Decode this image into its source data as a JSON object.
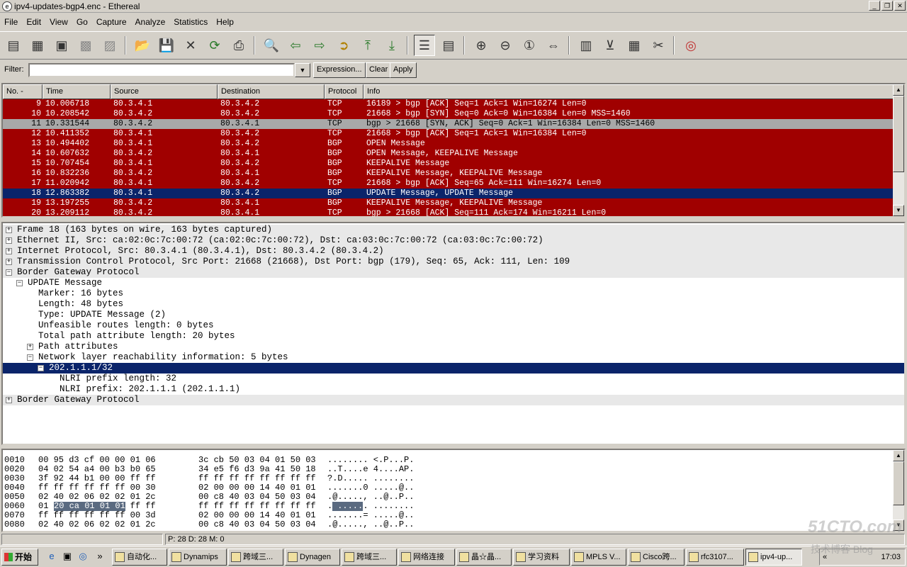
{
  "window": {
    "title": "ipv4-updates-bgp4.enc - Ethereal"
  },
  "menu": [
    "File",
    "Edit",
    "View",
    "Go",
    "Capture",
    "Analyze",
    "Statistics",
    "Help"
  ],
  "filter": {
    "label": "Filter:",
    "value": "",
    "expression": "Expression...",
    "clear": "Clear",
    "apply": "Apply"
  },
  "columns": [
    "No. -",
    "Time",
    "Source",
    "Destination",
    "Protocol",
    "Info"
  ],
  "colors": {
    "tcp_bg": "#a00000",
    "bgp_bg": "#a00000",
    "synack_bg": "#a8a8a8",
    "selected_bg": "#0a246a",
    "row_fg": "#ffffff"
  },
  "packets": [
    {
      "no": "9",
      "time": "10.006718",
      "src": "80.3.4.1",
      "dst": "80.3.4.2",
      "proto": "TCP",
      "info": "16189 > bgp [ACK] Seq=1 Ack=1 Win=16274 Len=0",
      "style": "red"
    },
    {
      "no": "10",
      "time": "10.208542",
      "src": "80.3.4.2",
      "dst": "80.3.4.2",
      "proto": "TCP",
      "info": "21668 > bgp [SYN] Seq=0 Ack=0 Win=16384 Len=0 MSS=1460",
      "style": "red"
    },
    {
      "no": "11",
      "time": "10.331544",
      "src": "80.3.4.2",
      "dst": "80.3.4.1",
      "proto": "TCP",
      "info": "bgp > 21668 [SYN, ACK] Seq=0 Ack=1 Win=16384 Len=0 MSS=1460",
      "style": "gray"
    },
    {
      "no": "12",
      "time": "10.411352",
      "src": "80.3.4.1",
      "dst": "80.3.4.2",
      "proto": "TCP",
      "info": "21668 > bgp [ACK] Seq=1 Ack=1 Win=16384 Len=0",
      "style": "red"
    },
    {
      "no": "13",
      "time": "10.494402",
      "src": "80.3.4.1",
      "dst": "80.3.4.2",
      "proto": "BGP",
      "info": "OPEN Message",
      "style": "red"
    },
    {
      "no": "14",
      "time": "10.607632",
      "src": "80.3.4.2",
      "dst": "80.3.4.1",
      "proto": "BGP",
      "info": "OPEN Message, KEEPALIVE Message",
      "style": "red"
    },
    {
      "no": "15",
      "time": "10.707454",
      "src": "80.3.4.1",
      "dst": "80.3.4.2",
      "proto": "BGP",
      "info": "KEEPALIVE Message",
      "style": "red"
    },
    {
      "no": "16",
      "time": "10.832236",
      "src": "80.3.4.2",
      "dst": "80.3.4.1",
      "proto": "BGP",
      "info": "KEEPALIVE Message, KEEPALIVE Message",
      "style": "red"
    },
    {
      "no": "17",
      "time": "11.020942",
      "src": "80.3.4.1",
      "dst": "80.3.4.2",
      "proto": "TCP",
      "info": "21668 > bgp [ACK] Seq=65 Ack=111 Win=16274 Len=0",
      "style": "red"
    },
    {
      "no": "18",
      "time": "12.863382",
      "src": "80.3.4.1",
      "dst": "80.3.4.2",
      "proto": "BGP",
      "info": "UPDATE Message, UPDATE Message",
      "style": "selected"
    },
    {
      "no": "19",
      "time": "13.197255",
      "src": "80.3.4.2",
      "dst": "80.3.4.1",
      "proto": "BGP",
      "info": "KEEPALIVE Message, KEEPALIVE Message",
      "style": "red"
    },
    {
      "no": "20",
      "time": "13.209112",
      "src": "80.3.4.2",
      "dst": "80.3.4.1",
      "proto": "TCP",
      "info": "bgp > 21668 [ACK] Seq=111 Ack=174 Win=16211 Len=0",
      "style": "red"
    }
  ],
  "details": [
    {
      "level": 0,
      "expander": "+",
      "text": "Frame 18 (163 bytes on wire, 163 bytes captured)",
      "shaded": true
    },
    {
      "level": 0,
      "expander": "+",
      "text": "Ethernet II, Src: ca:02:0c:7c:00:72 (ca:02:0c:7c:00:72), Dst: ca:03:0c:7c:00:72 (ca:03:0c:7c:00:72)",
      "shaded": true
    },
    {
      "level": 0,
      "expander": "+",
      "text": "Internet Protocol, Src: 80.3.4.1 (80.3.4.1), Dst: 80.3.4.2 (80.3.4.2)",
      "shaded": true
    },
    {
      "level": 0,
      "expander": "+",
      "text": "Transmission Control Protocol, Src Port: 21668 (21668), Dst Port: bgp (179), Seq: 65, Ack: 111, Len: 109",
      "shaded": true
    },
    {
      "level": 0,
      "expander": "-",
      "text": "Border Gateway Protocol",
      "shaded": true
    },
    {
      "level": 1,
      "expander": "-",
      "text": "UPDATE Message"
    },
    {
      "level": 2,
      "expander": "",
      "text": "Marker: 16 bytes"
    },
    {
      "level": 2,
      "expander": "",
      "text": "Length: 48 bytes"
    },
    {
      "level": 2,
      "expander": "",
      "text": "Type: UPDATE Message (2)"
    },
    {
      "level": 2,
      "expander": "",
      "text": "Unfeasible routes length: 0 bytes"
    },
    {
      "level": 2,
      "expander": "",
      "text": "Total path attribute length: 20 bytes"
    },
    {
      "level": 2,
      "expander": "+",
      "text": "Path attributes"
    },
    {
      "level": 2,
      "expander": "-",
      "text": "Network layer reachability information: 5 bytes"
    },
    {
      "level": 3,
      "expander": "-",
      "text": "202.1.1.1/32",
      "selected": true
    },
    {
      "level": 4,
      "expander": "",
      "text": "NLRI prefix length: 32"
    },
    {
      "level": 4,
      "expander": "",
      "text": "NLRI prefix: 202.1.1.1 (202.1.1.1)"
    },
    {
      "level": 0,
      "expander": "+",
      "text": "Border Gateway Protocol",
      "shaded": true
    }
  ],
  "hex": [
    {
      "off": "0010",
      "a": "00 95 d3 cf 00 00 01 06",
      "b": "3c cb 50 03 04 01 50 03",
      "ascii": "........ <.P...P."
    },
    {
      "off": "0020",
      "a": "04 02 54 a4 00 b3 b0 65",
      "b": "34 e5 f6 d3 9a 41 50 18",
      "ascii": "..T....e 4....AP."
    },
    {
      "off": "0030",
      "a": "3f 92 44 b1 00 00 ff ff",
      "b": "ff ff ff ff ff ff ff ff",
      "ascii": "?.D..... ........"
    },
    {
      "off": "0040",
      "a": "ff ff ff ff ff ff 00 30",
      "b": "02 00 00 00 14 40 01 01",
      "ascii": ".......0 .....@.."
    },
    {
      "off": "0050",
      "a": "02 40 02 06 02 02 01 2c",
      "b": "00 c8 40 03 04 50 03 04",
      "ascii": ".@....., ..@..P.."
    },
    {
      "off": "0060",
      "a": "01 20 ca 01 01 01 ff ff",
      "b": "ff ff ff ff ff ff ff ff",
      "ascii": ". ...... ........",
      "sel_hex": "20 ca 01 01 01",
      "sel_ascii": " ....."
    },
    {
      "off": "0070",
      "a": "ff ff ff ff ff ff 00 3d",
      "b": "02 00 00 00 14 40 01 01",
      "ascii": ".......= .....@.."
    },
    {
      "off": "0080",
      "a": "02 40 02 06 02 02 01 2c",
      "b": "00 c8 40 03 04 50 03 04",
      "ascii": ".@....., ..@..P.."
    }
  ],
  "status": {
    "left": "",
    "middle": "P: 28 D: 28 M: 0"
  },
  "taskbar": {
    "start": "开始",
    "tasks": [
      "自动化...",
      "Dynamips",
      "跨域三...",
      "Dynagen",
      "跨域三...",
      "网络连接",
      "晶☆晶...",
      "学习资料",
      "MPLS V...",
      "Cisco跨...",
      "rfc3107...",
      "ipv4-up..."
    ],
    "clock": "17:03"
  },
  "watermark": {
    "line1": "51CTO.com",
    "line2": "技术博客 Blog"
  }
}
